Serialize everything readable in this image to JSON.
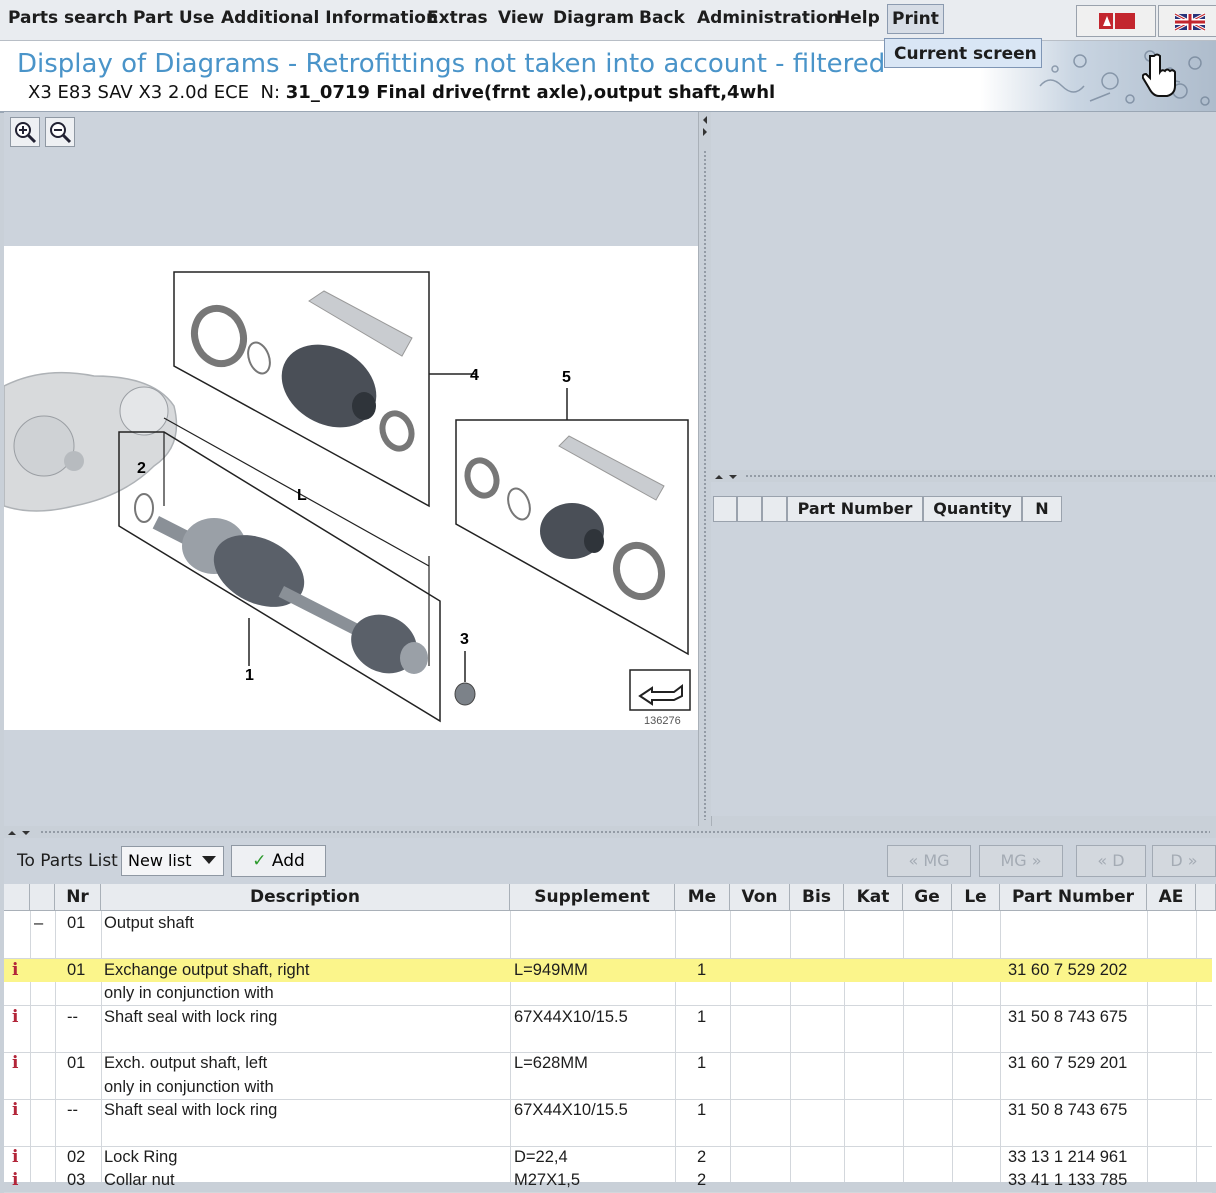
{
  "menu": {
    "items": [
      "Parts search",
      "Part Use",
      "Additional Information",
      "Extras",
      "View",
      "Diagram",
      "Back",
      "Administration",
      "Help",
      "Print"
    ],
    "print_dropdown_item": "Current screen"
  },
  "header": {
    "title": "Display of Diagrams - Retrofittings not taken into account - filtered",
    "vehicle": "X3 E83 SAV X3 2.0d ECE",
    "n_label": "N:",
    "diagram_name": "31_0719 Final drive(frnt axle),output shaft,4whl"
  },
  "diagram": {
    "callouts": [
      "1",
      "2",
      "3",
      "4",
      "5",
      "L"
    ],
    "image_number": "136276"
  },
  "parts_panel": {
    "columns": [
      "Part Number",
      "Quantity",
      "N"
    ]
  },
  "toolbar": {
    "to_parts_list": "To Parts List",
    "list_select": "New list",
    "add_label": "Add",
    "nav": [
      "« MG",
      "MG »",
      "« D",
      "D »"
    ]
  },
  "table": {
    "columns": [
      "Nr",
      "Description",
      "Supplement",
      "Me",
      "Von",
      "Bis",
      "Kat",
      "Ge",
      "Le",
      "Part Number",
      "AE"
    ],
    "rows": [
      {
        "expander": "–",
        "nr": "01",
        "desc": "Output shaft",
        "supp": "",
        "me": "",
        "pn": "",
        "info": false,
        "hl": false
      },
      {
        "expander": "",
        "nr": "",
        "desc": "",
        "supp": "",
        "me": "",
        "pn": "",
        "info": false,
        "hl": false
      },
      {
        "expander": "",
        "nr": "01",
        "desc": "Exchange output shaft, right",
        "supp": "L=949MM",
        "me": "1",
        "pn": "31 60 7 529 202",
        "info": true,
        "hl": true
      },
      {
        "expander": "",
        "nr": "",
        "desc": "only in conjunction with",
        "supp": "",
        "me": "",
        "pn": "",
        "info": false,
        "hl": false
      },
      {
        "expander": "",
        "nr": "--",
        "desc": "Shaft seal with lock ring",
        "supp": "67X44X10/15.5",
        "me": "1",
        "pn": "31 50 8 743 675",
        "info": true,
        "hl": false
      },
      {
        "expander": "",
        "nr": "",
        "desc": "",
        "supp": "",
        "me": "",
        "pn": "",
        "info": false,
        "hl": false
      },
      {
        "expander": "",
        "nr": "01",
        "desc": "Exch. output shaft, left",
        "supp": "L=628MM",
        "me": "1",
        "pn": "31 60 7 529 201",
        "info": true,
        "hl": false
      },
      {
        "expander": "",
        "nr": "",
        "desc": "only in conjunction with",
        "supp": "",
        "me": "",
        "pn": "",
        "info": false,
        "hl": false
      },
      {
        "expander": "",
        "nr": "--",
        "desc": "Shaft seal with lock ring",
        "supp": "67X44X10/15.5",
        "me": "1",
        "pn": "31 50 8 743 675",
        "info": true,
        "hl": false
      },
      {
        "expander": "",
        "nr": "",
        "desc": "",
        "supp": "",
        "me": "",
        "pn": "",
        "info": false,
        "hl": false
      },
      {
        "expander": "",
        "nr": "02",
        "desc": "Lock Ring",
        "supp": "D=22,4",
        "me": "2",
        "pn": "33 13 1 214 961",
        "info": true,
        "hl": false
      },
      {
        "expander": "",
        "nr": "03",
        "desc": "Collar nut",
        "supp": "M27X1,5",
        "me": "2",
        "pn": "33 41 1 133 785",
        "info": true,
        "hl": false
      }
    ]
  }
}
